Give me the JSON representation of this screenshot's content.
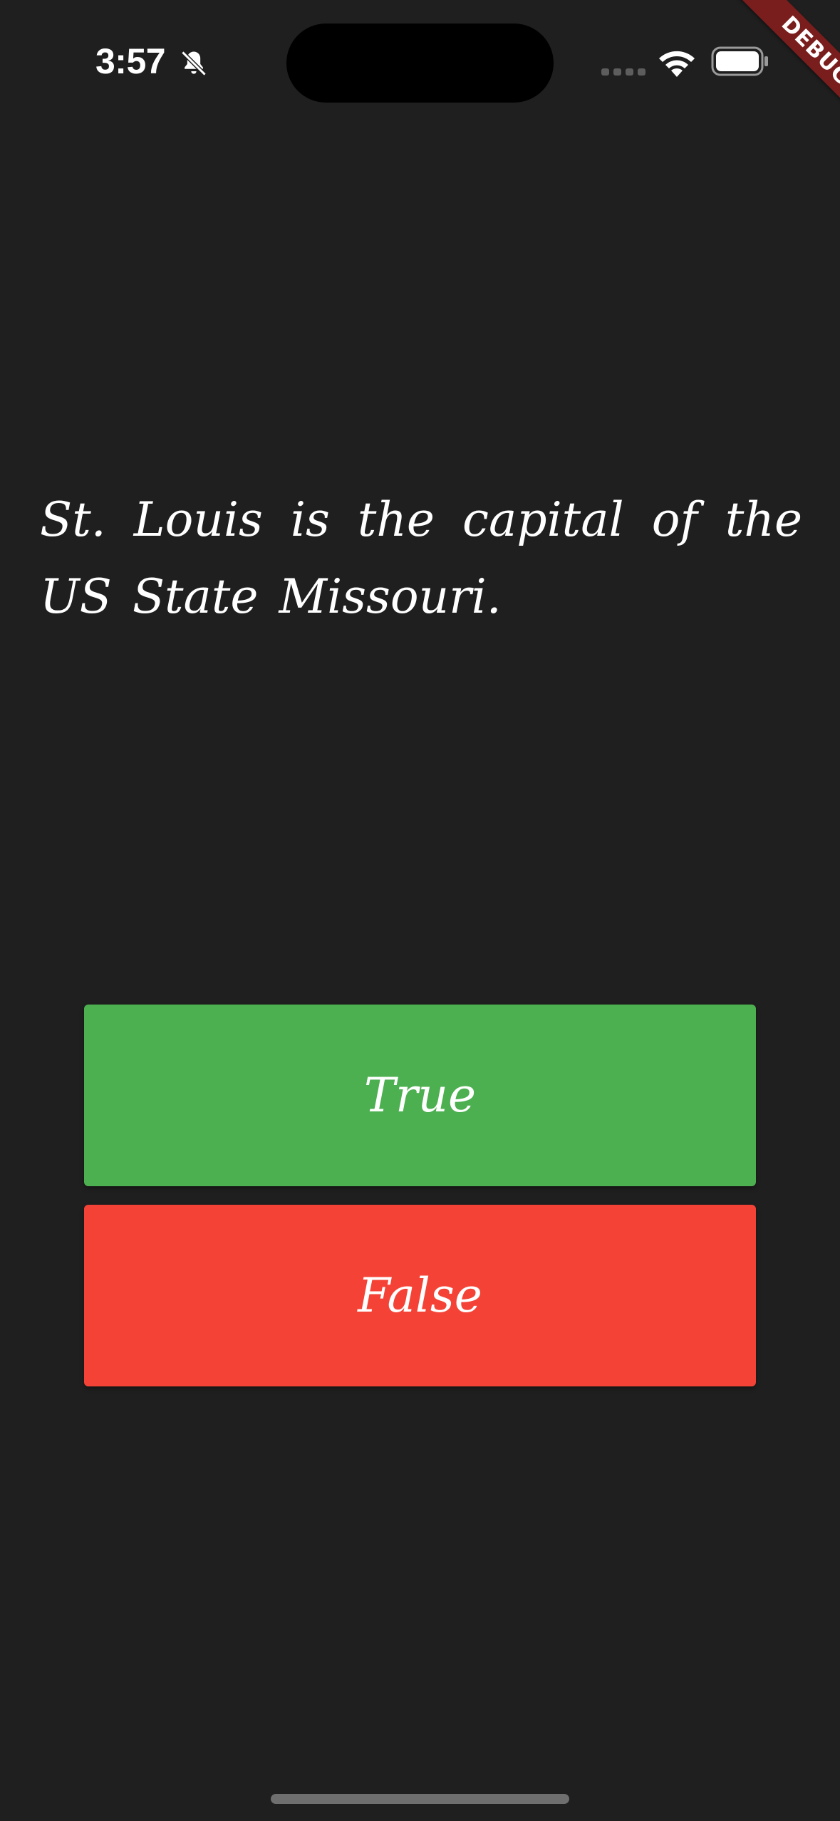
{
  "status_bar": {
    "time": "3:57",
    "icons": [
      "bell-slash-icon",
      "cellular-signal-icon",
      "wifi-icon",
      "battery-icon"
    ]
  },
  "debug_banner": {
    "label": "DEBUG",
    "color": "#7a1d1d"
  },
  "quiz": {
    "question": "St. Louis is the capital of the US State Missouri."
  },
  "answers": {
    "true_label": "True",
    "false_label": "False",
    "true_color": "#4caf50",
    "false_color": "#f44336"
  },
  "theme": {
    "background": "#1f1f1f",
    "text": "#ffffff"
  }
}
